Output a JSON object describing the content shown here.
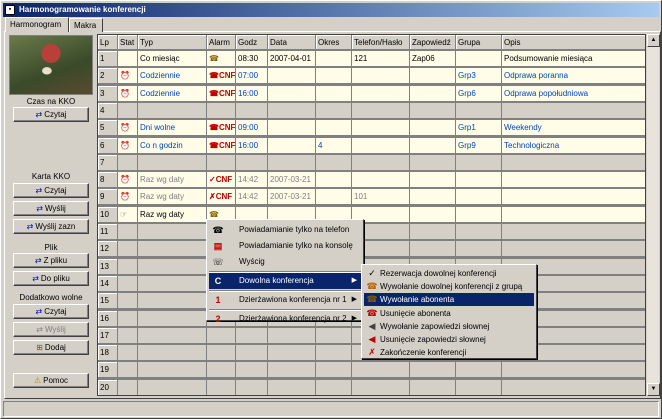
{
  "window": {
    "title": "Harmonogramowanie konferencji"
  },
  "tabs": [
    {
      "label": "Harmonogram"
    },
    {
      "label": "Makra"
    }
  ],
  "left_panel": {
    "sections": [
      {
        "label": "Czas na KKO",
        "buttons": [
          "Czytaj"
        ]
      },
      {
        "label": "Karta KKO",
        "buttons": [
          "Czytaj",
          "Wyślij",
          "Wyślij zazn"
        ]
      },
      {
        "label": "Plik",
        "buttons": [
          "Z pliku",
          "Do pliku"
        ]
      },
      {
        "label": "Dodatkowo wolne",
        "buttons": [
          "Czytaj",
          "Wyślij",
          "Dodaj"
        ]
      }
    ],
    "help_button": "Pomoc"
  },
  "grid": {
    "columns": [
      "Lp",
      "Stat",
      "Typ",
      "Alarm",
      "Godz",
      "Data",
      "Okres",
      "Telefon/Hasło",
      "Zapowiedź",
      "Grupa",
      "Opis"
    ],
    "rows": [
      {
        "lp": "1",
        "stat": "",
        "typ": "Co miesiąc",
        "alarm": "phone",
        "godz": "08:30",
        "data": "2007-04-01",
        "okres": "",
        "tel": "121",
        "zap": "Zap06",
        "grupa": "",
        "opis": "Podsumowanie miesiąca",
        "style": "d"
      },
      {
        "lp": "2",
        "stat": "clock",
        "typ": "Codziennie",
        "alarm": "cnf",
        "godz": "07:00",
        "data": "",
        "okres": "",
        "tel": "",
        "zap": "",
        "grupa": "Grp3",
        "opis": "Odprawa poranna",
        "style": "blue"
      },
      {
        "lp": "3",
        "stat": "clock",
        "typ": "Codziennie",
        "alarm": "cnf",
        "godz": "16:00",
        "data": "",
        "okres": "",
        "tel": "",
        "zap": "",
        "grupa": "Grp6",
        "opis": "Odprawa popołudniowa",
        "style": "blue"
      },
      {
        "lp": "4",
        "stat": "",
        "typ": "",
        "alarm": "",
        "godz": "",
        "data": "",
        "okres": "",
        "tel": "",
        "zap": "",
        "grupa": "",
        "opis": "",
        "style": "empty"
      },
      {
        "lp": "5",
        "stat": "clock",
        "typ": "Dni wolne",
        "alarm": "cnf",
        "godz": "09:00",
        "data": "",
        "okres": "",
        "tel": "",
        "zap": "",
        "grupa": "Grp1",
        "opis": "Weekendy",
        "style": "blue"
      },
      {
        "lp": "6",
        "stat": "clock",
        "typ": "Co n godzin",
        "alarm": "cnf",
        "godz": "16:00",
        "data": "",
        "okres": "4",
        "tel": "",
        "zap": "",
        "grupa": "Grp9",
        "opis": "Technologiczna",
        "style": "blue"
      },
      {
        "lp": "7",
        "stat": "",
        "typ": "",
        "alarm": "",
        "godz": "",
        "data": "",
        "okres": "",
        "tel": "",
        "zap": "",
        "grupa": "",
        "opis": "",
        "style": "empty"
      },
      {
        "lp": "8",
        "stat": "clock",
        "typ": "Raz wg daty",
        "alarm": "checkcnf",
        "godz": "14:42",
        "data": "2007-03-21",
        "okres": "",
        "tel": "",
        "zap": "",
        "grupa": "",
        "opis": "",
        "style": "gray"
      },
      {
        "lp": "9",
        "stat": "clock",
        "typ": "Raz wg daty",
        "alarm": "xcnf",
        "godz": "14:42",
        "data": "2007-03-21",
        "okres": "",
        "tel": "101",
        "zap": "",
        "grupa": "",
        "opis": "",
        "style": "gray"
      },
      {
        "lp": "10",
        "stat": "hand",
        "typ": "Raz wg daty",
        "alarm": "phone",
        "godz": "",
        "data": "",
        "okres": "",
        "tel": "",
        "zap": "",
        "grupa": "",
        "opis": "",
        "style": "d"
      },
      {
        "lp": "11",
        "style": "empty"
      },
      {
        "lp": "12",
        "style": "empty"
      },
      {
        "lp": "13",
        "style": "empty"
      },
      {
        "lp": "14",
        "style": "empty"
      },
      {
        "lp": "15",
        "style": "empty"
      },
      {
        "lp": "16",
        "style": "empty"
      },
      {
        "lp": "17",
        "style": "empty"
      },
      {
        "lp": "18",
        "style": "empty"
      },
      {
        "lp": "19",
        "style": "empty"
      },
      {
        "lp": "20",
        "style": "empty"
      }
    ]
  },
  "context_menu": {
    "items": [
      {
        "label": "Powiadamianie tylko na telefon",
        "icon": "phone-icon"
      },
      {
        "label": "Powiadamianie tylko na konsolę",
        "icon": "console-icon"
      },
      {
        "label": "Wyścig",
        "icon": "race-icon"
      },
      {
        "label": "Dowolna konferencja",
        "icon": "cnf-icon",
        "submenu": true,
        "selected": true
      },
      {
        "label": "Dzierżawiona konferencja nr 1",
        "icon": "cf1-icon",
        "submenu": true
      },
      {
        "label": "Dzierżawiona konferencja nr 2",
        "icon": "cf2-icon",
        "submenu": true
      }
    ]
  },
  "submenu": {
    "items": [
      {
        "label": "Rezerwacja dowolnej konferencji",
        "icon": "check-icon"
      },
      {
        "label": "Wywołanie dowolnej konferencji z grupą",
        "icon": "group-call-icon"
      },
      {
        "label": "Wywołanie abonenta",
        "icon": "phone-call-icon",
        "selected": true
      },
      {
        "label": "Usunięcie abonenta",
        "icon": "remove-subscriber-icon"
      },
      {
        "label": "Wywołanie zapowiedzi słownej",
        "icon": "speaker-icon"
      },
      {
        "label": "Usunięcie zapowiedzi słownej",
        "icon": "speaker-remove-icon"
      },
      {
        "label": "Zakończenie konferencji",
        "icon": "end-conference-icon"
      }
    ]
  }
}
